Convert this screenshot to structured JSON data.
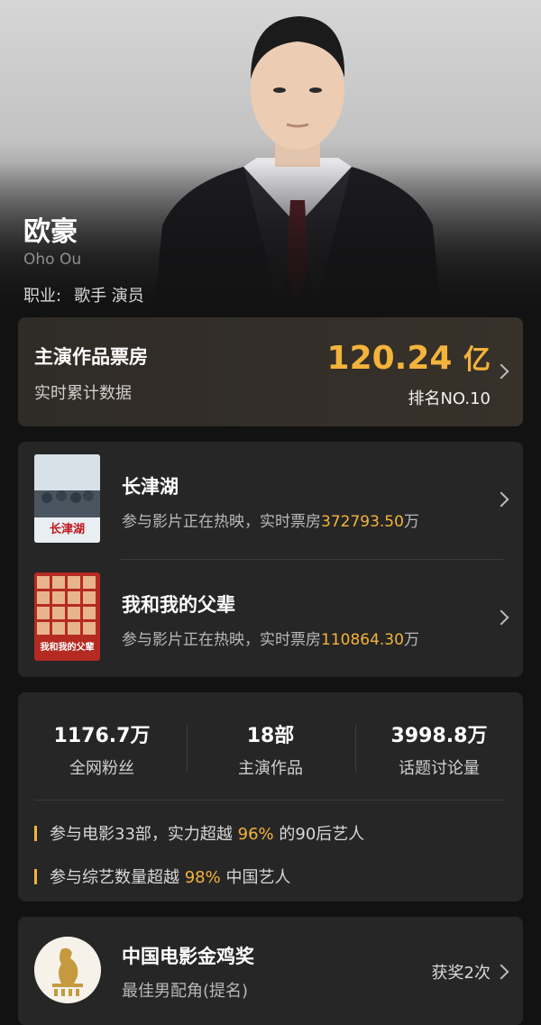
{
  "profile": {
    "name": "欧豪",
    "english_name": "Oho Ou",
    "occupation_label": "职业:",
    "occupation_value": "歌手 演员"
  },
  "box_office": {
    "title": "主演作品票房",
    "subtitle": "实时累计数据",
    "value": "120.24",
    "unit": "亿",
    "rank": "排名NO.10"
  },
  "films": [
    {
      "title": "长津湖",
      "desc_prefix": "参与影片正在热映，实时票房",
      "box_value": "372793.50",
      "unit": "万",
      "poster_text": "长津湖"
    },
    {
      "title": "我和我的父辈",
      "desc_prefix": "参与影片正在热映，实时票房",
      "box_value": "110864.30",
      "unit": "万",
      "poster_text": "我和我的父辈"
    }
  ],
  "stats": [
    {
      "value": "1176.7万",
      "label": "全网粉丝"
    },
    {
      "value": "18部",
      "label": "主演作品"
    },
    {
      "value": "3998.8万",
      "label": "话题讨论量"
    }
  ],
  "facts": [
    {
      "pre": "参与电影33部，实力超越 ",
      "hl": "96%",
      "post": " 的90后艺人"
    },
    {
      "pre": "参与综艺数量超越 ",
      "hl": "98%",
      "post": " 中国艺人"
    }
  ],
  "award": {
    "title": "中国电影金鸡奖",
    "subtitle": "最佳男配角(提名)",
    "count": "获奖2次"
  },
  "colors": {
    "accent": "#f4b33a",
    "background": "#121212",
    "card": "#262626"
  },
  "icons": [
    "chevron-right-icon",
    "golden-rooster-logo"
  ]
}
